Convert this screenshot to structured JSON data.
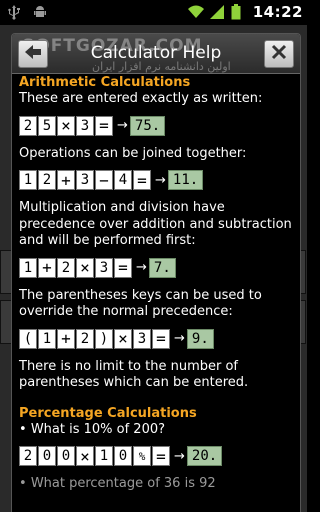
{
  "status_bar": {
    "time": "14:22",
    "icons": [
      "usb-icon",
      "android-debug-icon",
      "wifi-icon",
      "signal-icon",
      "battery-icon"
    ]
  },
  "dialog": {
    "title": "Calculator Help",
    "watermark": "SOFTGOZAR.COM",
    "watermark_sub": "اولین دانشنامه نرم افزار ایران"
  },
  "help": {
    "arithmetic_heading": "Arithmetic Calculations",
    "arithmetic_intro": "These are entered exactly as written:",
    "ex1": {
      "keys": [
        "2",
        "5",
        "×",
        "3",
        "="
      ],
      "result": "75."
    },
    "ops_joined": "Operations can be joined together:",
    "ex2": {
      "keys": [
        "1",
        "2",
        "+",
        "3",
        "−",
        "4",
        "="
      ],
      "result": "11."
    },
    "precedence": "Multiplication and division have precedence over addition and subtraction and will be performed first:",
    "ex3": {
      "keys": [
        "1",
        "+",
        "2",
        "×",
        "3",
        "="
      ],
      "result": "7."
    },
    "parentheses": "The parentheses keys can be used to override the normal precedence:",
    "ex4": {
      "keys": [
        "(",
        "1",
        "+",
        "2",
        ")",
        "×",
        "3",
        "="
      ],
      "result": "9."
    },
    "no_limit": "There is no limit to the number of parentheses which can be entered.",
    "percentage_heading": "Percentage Calculations",
    "q1": "What is 10% of 200?",
    "ex5": {
      "keys": [
        "2",
        "0",
        "0",
        "×",
        "1",
        "0",
        "%",
        "="
      ],
      "result": "20."
    },
    "q2": "What percentage of 36 is 92"
  }
}
